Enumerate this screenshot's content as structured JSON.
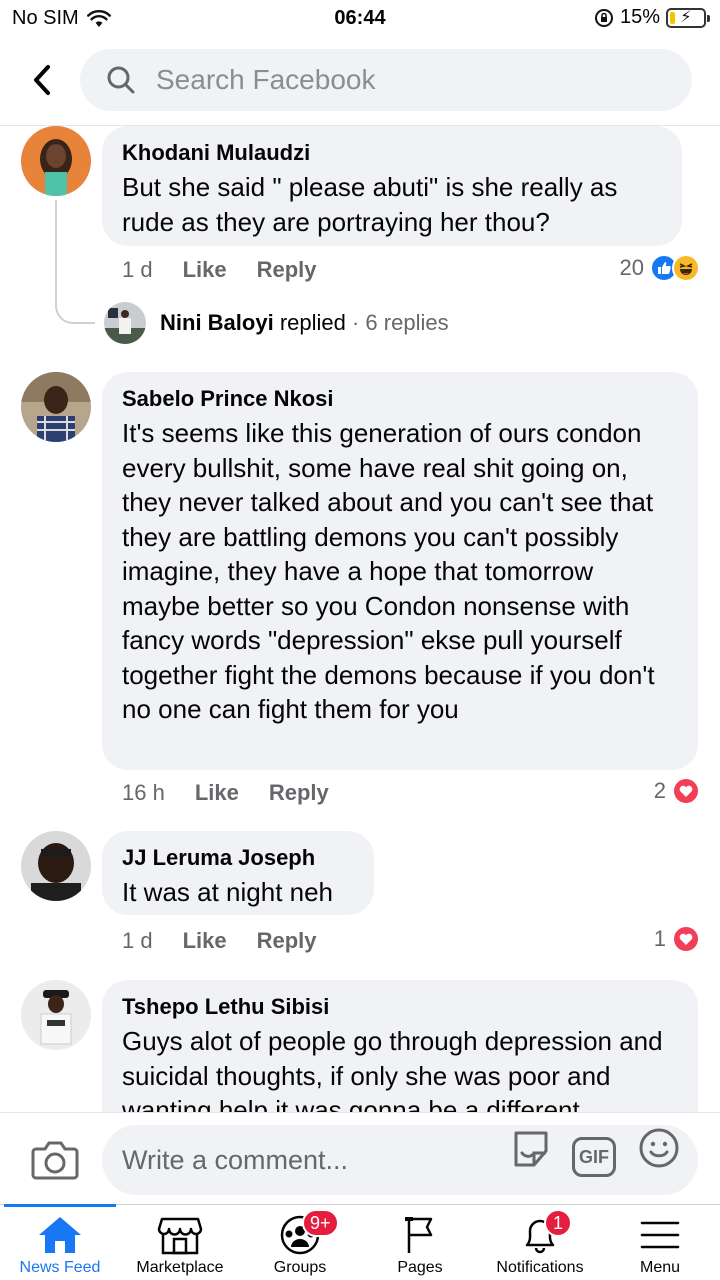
{
  "status_bar": {
    "carrier": "No SIM",
    "time": "06:44",
    "battery": "15%",
    "battery_level": 0.15
  },
  "header": {
    "search_placeholder": "Search Facebook"
  },
  "comments": [
    {
      "author": "Khodani Mulaudzi",
      "text": "But she said \" please abuti\" is she really as rude as they are portraying her thou?",
      "time": "1 d",
      "like": "Like",
      "reply": "Reply",
      "reaction_count": "20",
      "reactions": [
        "like-reaction-icon",
        "haha-reaction-icon"
      ],
      "reply_summary": {
        "name": "Nini Baloyi",
        "action": "replied",
        "count": "· 6 replies"
      }
    },
    {
      "author": "Sabelo Prince Nkosi",
      "text": "It's seems like this generation of ours condon every bullshit, some have real shit going on, they never talked about and you can't see that they are battling demons you can't possibly imagine, they have a hope that tomorrow maybe better so you Condon nonsense with fancy words \"depression\" ekse pull yourself together fight the demons because if you don't no one can fight them for you",
      "time": "16 h",
      "like": "Like",
      "reply": "Reply",
      "reaction_count": "2",
      "reactions": [
        "love-reaction-icon"
      ]
    },
    {
      "author": "JJ Leruma Joseph",
      "text": "It was at night neh",
      "time": "1 d",
      "like": "Like",
      "reply": "Reply",
      "reaction_count": "1",
      "reactions": [
        "love-reaction-icon"
      ]
    },
    {
      "author": "Tshepo Lethu Sibisi",
      "text": "Guys alot of people go through depression and suicidal thoughts, if only she was poor and wanting help it was gonna be a different"
    }
  ],
  "composer": {
    "placeholder": "Write a comment...",
    "gif_label": "GIF"
  },
  "tabs": [
    {
      "label": "News Feed",
      "icon": "home-icon",
      "active": true
    },
    {
      "label": "Marketplace",
      "icon": "marketplace-icon"
    },
    {
      "label": "Groups",
      "icon": "groups-icon",
      "badge": "9+"
    },
    {
      "label": "Pages",
      "icon": "flag-icon"
    },
    {
      "label": "Notifications",
      "icon": "bell-icon",
      "badge": "1"
    },
    {
      "label": "Menu",
      "icon": "menu-icon"
    }
  ],
  "colors": {
    "accent": "#1877f2",
    "bubble": "#f0f2f5",
    "secondary_text": "#65676b",
    "badge": "#e41e3f",
    "love": "#f33e58",
    "haha": "#f7b928"
  }
}
